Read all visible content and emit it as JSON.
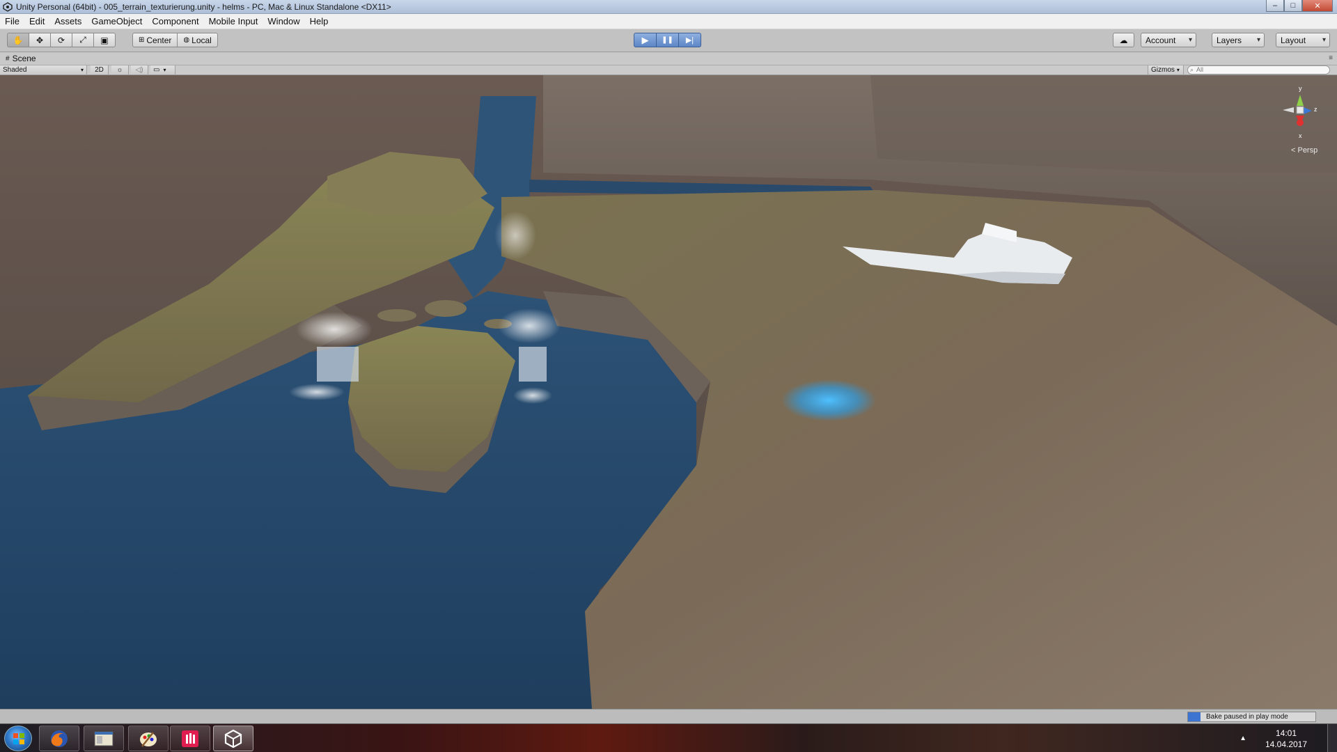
{
  "window": {
    "title": "Unity Personal (64bit) - 005_terrain_texturierung.unity - helms - PC, Mac & Linux Standalone <DX11>",
    "controls": {
      "minimize": "–",
      "maximize": "□",
      "close": "✕"
    }
  },
  "menu": {
    "items": [
      {
        "label": "File"
      },
      {
        "label": "Edit"
      },
      {
        "label": "Assets"
      },
      {
        "label": "GameObject"
      },
      {
        "label": "Component"
      },
      {
        "label": "Mobile Input"
      },
      {
        "label": "Window"
      },
      {
        "label": "Help"
      }
    ]
  },
  "toolbar": {
    "tools": [
      {
        "name": "hand-tool-icon",
        "glyph": "✋"
      },
      {
        "name": "move-tool-icon",
        "glyph": "✥"
      },
      {
        "name": "rotate-tool-icon",
        "glyph": "⟳"
      },
      {
        "name": "scale-tool-icon",
        "glyph": "⤢"
      },
      {
        "name": "rect-tool-icon",
        "glyph": "▣"
      }
    ],
    "pivot_label": "Center",
    "rotation_label": "Local",
    "play_glyph": "▶",
    "pause_glyph": "❚❚",
    "step_glyph": "▶|",
    "account_label": "Account",
    "layers_label": "Layers",
    "layout_label": "Layout"
  },
  "scene": {
    "tab_label": "Scene",
    "shading_mode": "Shaded",
    "mode_2d_label": "2D",
    "gizmos_label": "Gizmos",
    "search_placeholder": "All",
    "projection_label": "< Persp",
    "axis_labels": {
      "x": "x",
      "y": "y",
      "z": "z"
    }
  },
  "status": {
    "bake_text": "Bake paused in play mode",
    "bake_progress_fraction": 0.1
  },
  "taskbar": {
    "apps": [
      {
        "name": "firefox-icon"
      },
      {
        "name": "file-explorer-icon"
      },
      {
        "name": "paint-icon"
      },
      {
        "name": "red-app-icon"
      },
      {
        "name": "unity-icon"
      }
    ],
    "clock_time": "14:01",
    "clock_date": "14.04.2017"
  },
  "colors": {
    "play_accent": "#5d86c6",
    "water": "#2d5478",
    "terrain_ground": "#7c6d5c",
    "grass": "#7f7a45",
    "cliff": "#6b6058",
    "bake_bar": "#3d73d1"
  }
}
